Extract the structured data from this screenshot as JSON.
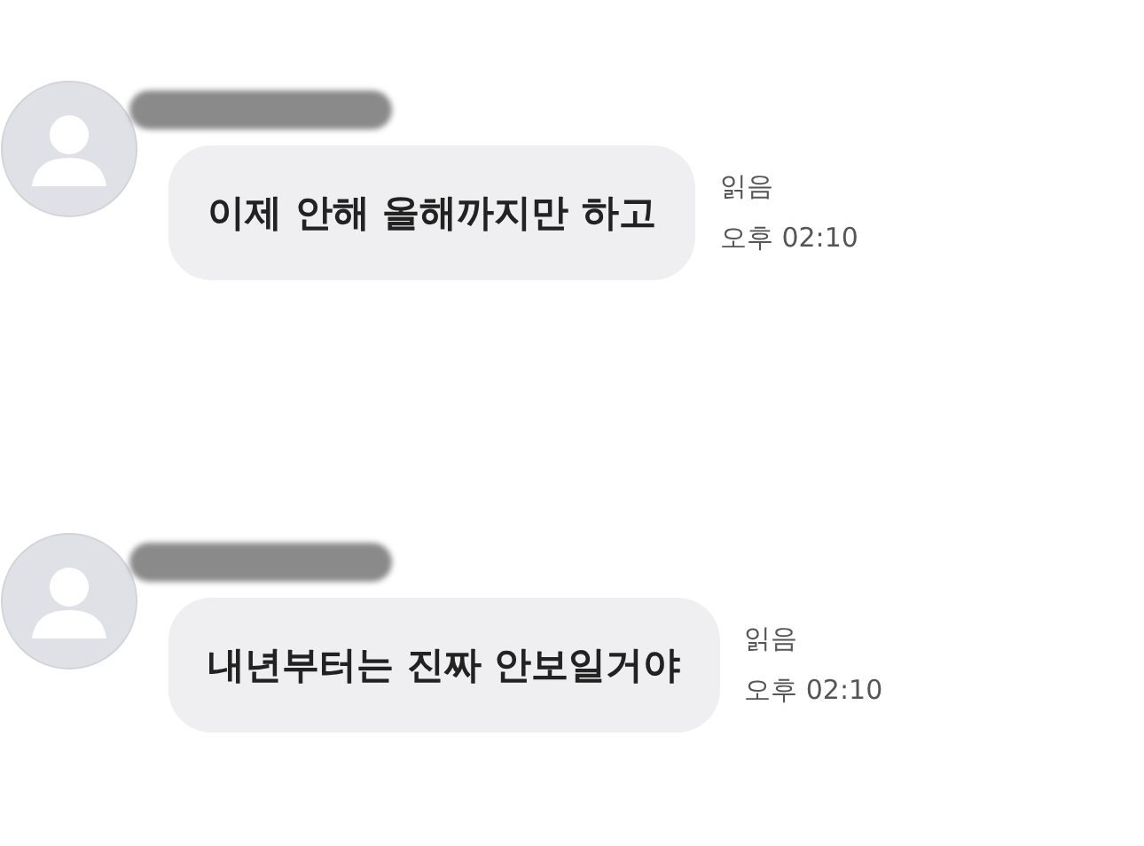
{
  "messages": [
    {
      "text": "이제 안해 올해까지만 하고",
      "read_label": "읽음",
      "time": "오후 02:10"
    },
    {
      "text": "내년부터는 진짜 안보일거야",
      "read_label": "읽음",
      "time": "오후 02:10"
    }
  ]
}
